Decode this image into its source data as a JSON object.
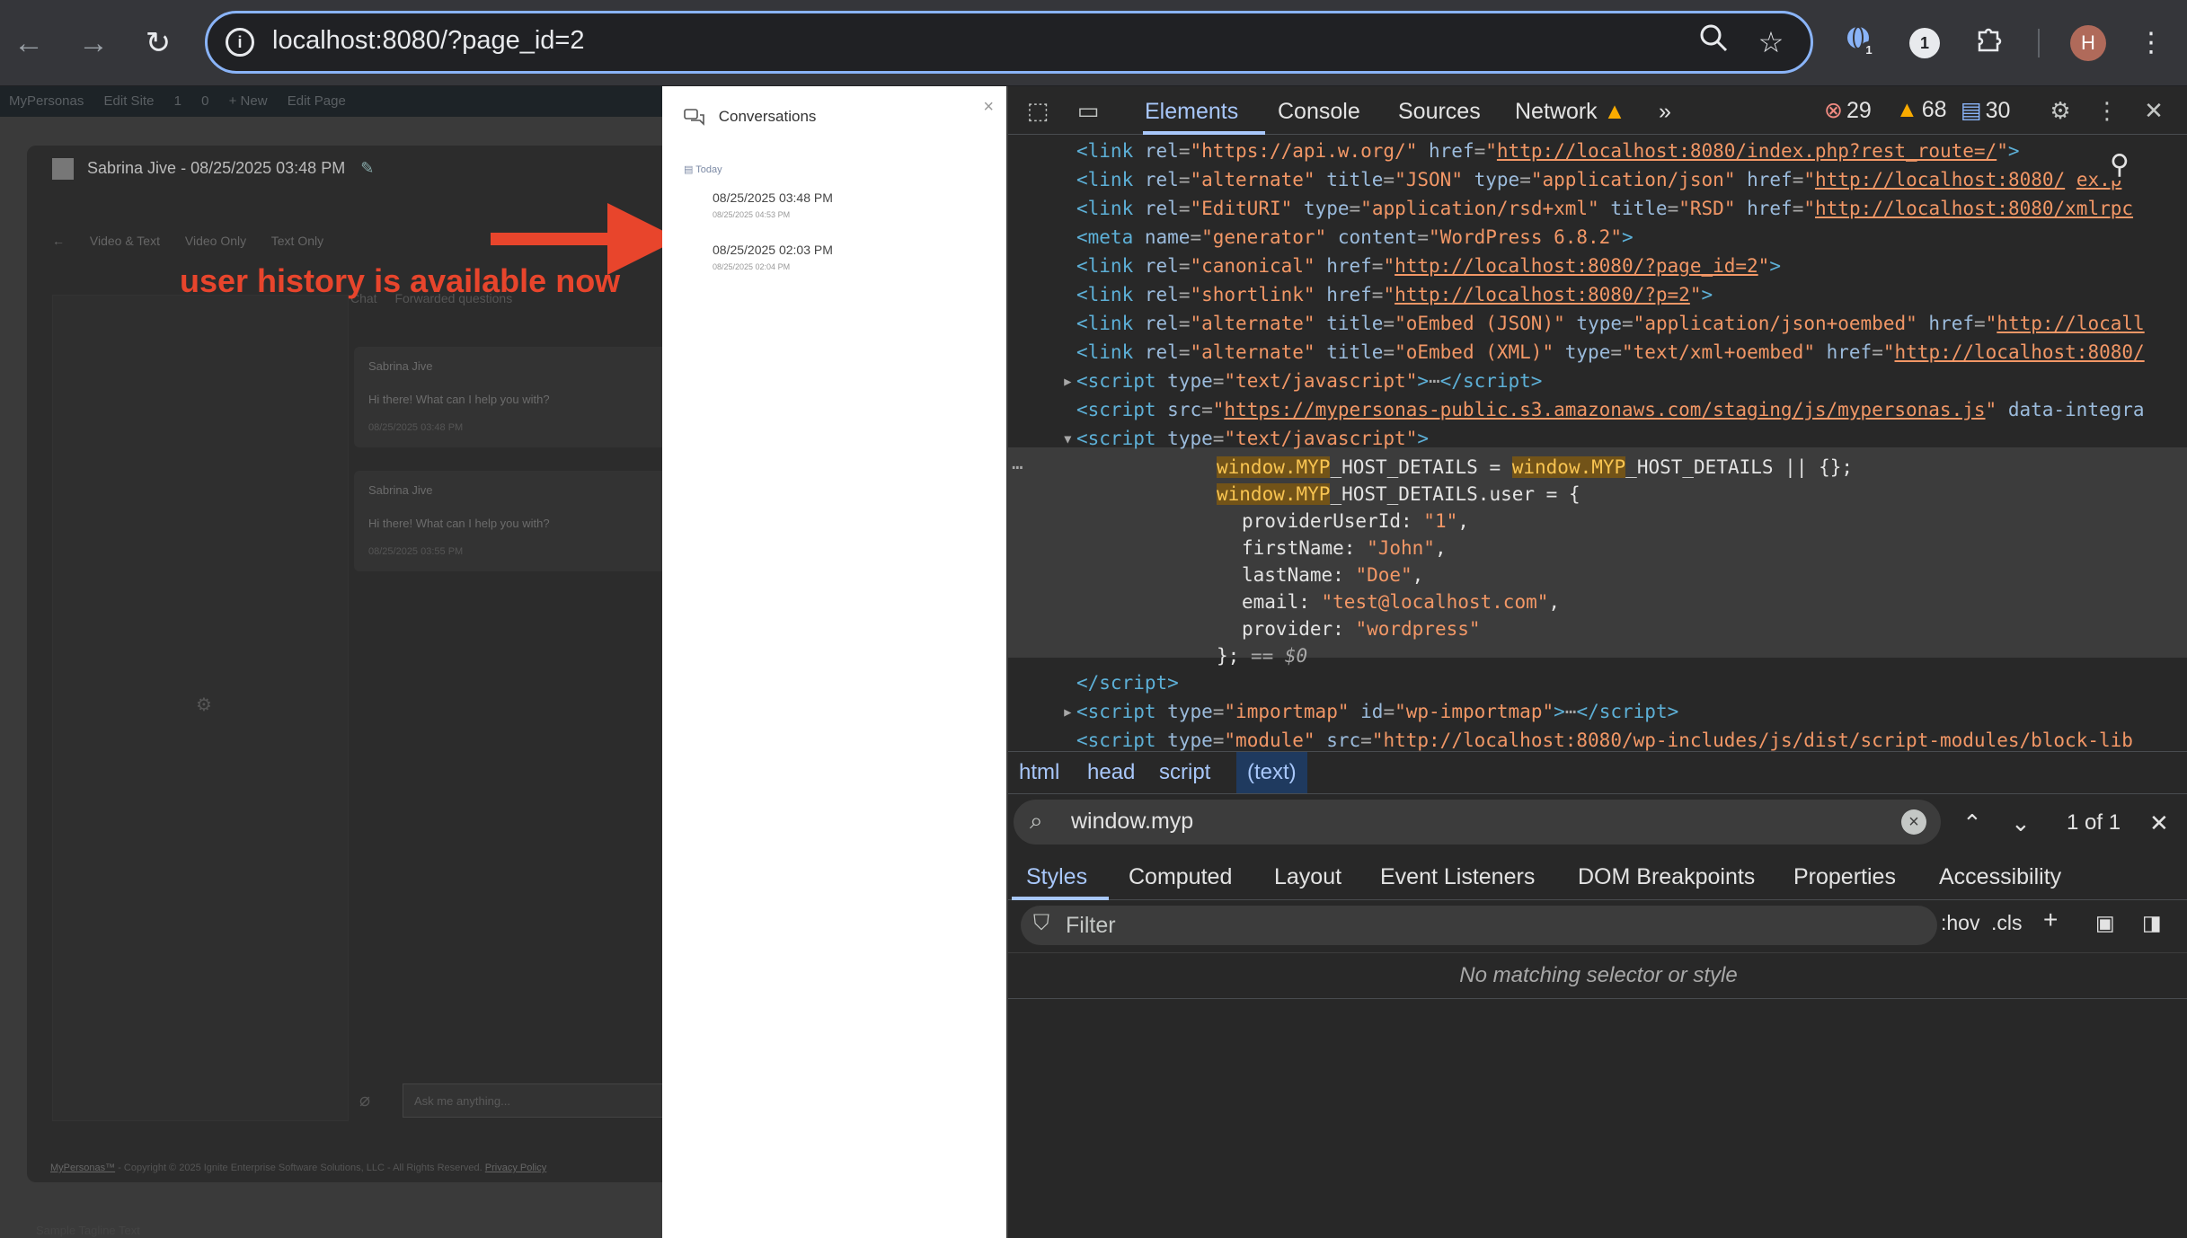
{
  "browser": {
    "url": "localhost:8080/?page_id=2",
    "back_icon": "←",
    "forward_icon": "→",
    "reload_icon": "↻",
    "extension_badge_1": "1",
    "extension_badge_2": "1",
    "profile_initial": "H"
  },
  "wp_admin_bar": {
    "items": [
      "MyPersonas",
      "Edit Site",
      "1",
      "0",
      "+ New",
      "Edit Page"
    ]
  },
  "chat_app": {
    "title": "Sabrina Jive - 08/25/2025 03:48 PM",
    "modes": [
      "Video & Text",
      "Video Only",
      "Text Only"
    ],
    "tabs": [
      "Chat",
      "Forwarded questions"
    ],
    "messages": [
      {
        "sender": "Sabrina Jive",
        "text": "Hi there! What can I help you with?",
        "time": "08/25/2025 03:48 PM"
      },
      {
        "sender": "Sabrina Jive",
        "text": "Hi there! What can I help you with?",
        "time": "08/25/2025 03:55 PM"
      }
    ],
    "input_placeholder": "Ask me anything...",
    "footer_brand": "MyPersonas™",
    "footer_text": " - Copyright © 2025 Ignite Enterprise Software Solutions, LLC - All Rights Reserved. ",
    "footer_link": "Privacy Policy",
    "site_tagline": "Sample Tagline Text"
  },
  "annotation": {
    "text": "user history is available now",
    "color": "#e8452c"
  },
  "conversations_panel": {
    "title": "Conversations",
    "close_label": "×",
    "group_label": "Today",
    "items": [
      {
        "title": "08/25/2025 03:48 PM",
        "subtitle": "08/25/2025 04:53 PM"
      },
      {
        "title": "08/25/2025 02:03 PM",
        "subtitle": "08/25/2025 02:04 PM"
      }
    ]
  },
  "devtools": {
    "tabs": [
      "Elements",
      "Console",
      "Sources",
      "Network"
    ],
    "more_tabs_icon": "»",
    "errors": "29",
    "warnings": "68",
    "messages": "30",
    "breadcrumb": [
      "html",
      "head",
      "script",
      "(text)"
    ],
    "search_query": "window.myp",
    "search_count": "1 of 1",
    "subtabs": [
      "Styles",
      "Computed",
      "Layout",
      "Event Listeners",
      "DOM Breakpoints",
      "Properties",
      "Accessibility"
    ],
    "filter_placeholder": "Filter",
    "hov_label": ":hov",
    "cls_label": ".cls",
    "no_match": "No matching selector or style",
    "code": {
      "l1_href": "https://api.w.org/",
      "l1_href2": "http://localhost:8080/index.php?rest_route=/",
      "l2_title": "JSON",
      "l2_type": "application/json",
      "l2_href": "http://localhost:8080/",
      "l2_tail": "ex.p",
      "l3_type": "application/rsd+xml",
      "l3_title": "RSD",
      "l3_href": "http://localhost:8080/xmlrpc",
      "meta_content": "WordPress 6.8.2",
      "canonical_href": "http://localhost:8080/?page_id=2",
      "shortlink_href": "http://localhost:8080/?p=2",
      "oembed_json_title": "oEmbed (JSON)",
      "oembed_json_type": "application/json+oembed",
      "oembed_json_href": "http://locall",
      "oembed_xml_title": "oEmbed (XML)",
      "oembed_xml_type": "text/xml+oembed",
      "oembed_xml_href": "http://localhost:8080/",
      "script_src": "https://mypersonas-public.s3.amazonaws.com/staging/js/mypersonas.js",
      "script_tail": "data-integra",
      "provider_user_id": "\"1\"",
      "first_name": "\"John\"",
      "last_name": "\"Doe\"",
      "email": "\"test@localhost.com\"",
      "provider": "\"wordpress\"",
      "importmap_id": "wp-importmap",
      "module_src": "http://localhost:8080/wp-includes/js/dist/script-modules/block-lib"
    }
  }
}
